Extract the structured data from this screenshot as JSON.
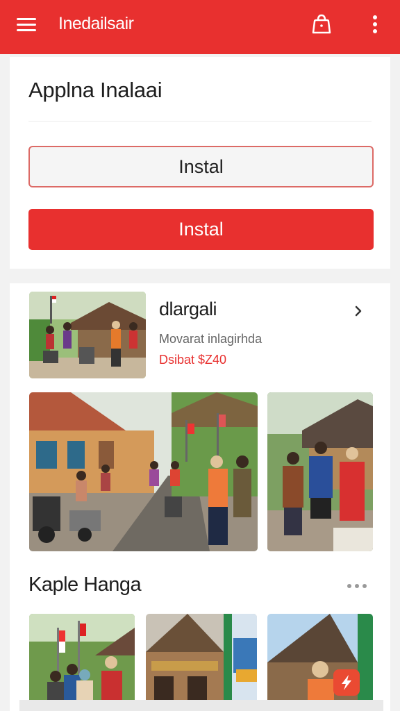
{
  "header": {
    "title": "Inedailsair",
    "background": "#e8302f",
    "icons": [
      "menu-icon",
      "shopping-bag-icon",
      "more-vertical-icon"
    ]
  },
  "install": {
    "heading": "Applna Inalaai",
    "outline_button_label": "Instal",
    "primary_button_label": "Instal",
    "accent": "#e8302f"
  },
  "product": {
    "title": "dlargali",
    "subtitle": "Movarat inlagirhda",
    "price": "Dsibat $Z40",
    "price_color": "#e8302f"
  },
  "section": {
    "title": "Kaple Hanga"
  },
  "icons": {
    "chevron": "chevron-right-icon",
    "section_more": "more-horizontal-icon",
    "fab": "lightning-icon"
  }
}
